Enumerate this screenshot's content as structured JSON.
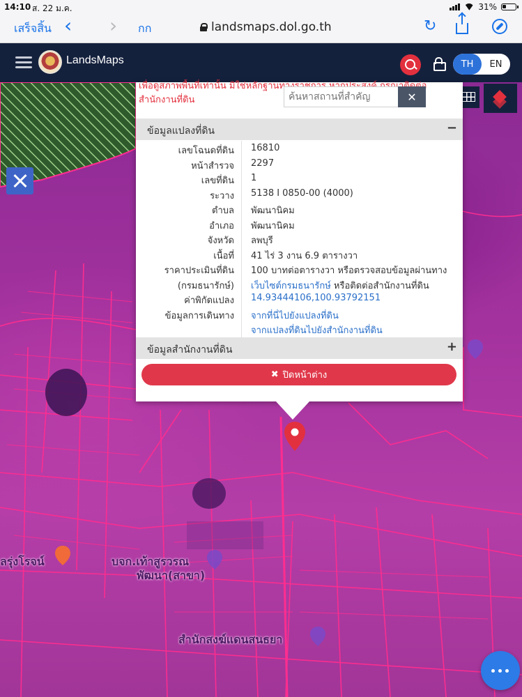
{
  "status_bar": {
    "time": "14:10",
    "date": "ส. 22 ม.ค.",
    "battery": "31%"
  },
  "browser": {
    "done_label": "เสร็จสิ้น",
    "back_glyph": "‹",
    "forward_glyph": "›",
    "text_size_label": "กก",
    "url": "landsmaps.dol.go.th",
    "reload_glyph": "↻"
  },
  "app": {
    "brand": "LandsMaps",
    "lang_th": "TH",
    "lang_en": "EN"
  },
  "popup": {
    "warning": "เพื่อดูสภาพพื้นที่เท่านั้น มิใช่หลักฐานทางราชการ หากประสงค์ กรุณาติดต่อ สำนักงานที่ดิน",
    "search_placeholder": "ค้นหาสถานที่สำคัญ",
    "search_close": "✕",
    "section_parcel": "ข้อมูลแปลงที่ดิน",
    "section_parcel_toggle": "−",
    "section_office": "ข้อมูลสำนักงานที่ดิน",
    "section_office_toggle": "+",
    "rows": [
      {
        "label": "เลขโฉนดที่ดิน",
        "value": "16810"
      },
      {
        "label": "หน้าสำรวจ",
        "value": "2297"
      },
      {
        "label": "เลขที่ดิน",
        "value": "1"
      },
      {
        "label": "ระวาง",
        "value": "5138 I 0850-00 (4000)"
      },
      {
        "label": "ตำบล",
        "value": "พัฒนานิคม"
      },
      {
        "label": "อำเภอ",
        "value": "พัฒนานิคม"
      },
      {
        "label": "จังหวัด",
        "value": "ลพบุรี"
      },
      {
        "label": "เนื้อที่",
        "value": "41 ไร่ 3 งาน 6.9 ตารางวา"
      },
      {
        "label": "ราคาประเมินที่ดิน",
        "value": "100 บาทต่อตารางวา หรือตรวจสอบข้อมูลผ่านทาง"
      },
      {
        "label": "(กรมธนารักษ์)",
        "link": "เว็บไซต์กรมธนารักษ์",
        "value": " หรือติดต่อสำนักงานที่ดิน"
      },
      {
        "label": "ค่าพิกัดแปลง",
        "link": "14.93444106,100.93792151"
      },
      {
        "label": "ข้อมูลการเดินทาง",
        "link": "จากที่นี่ไปยังแปลงที่ดิน"
      },
      {
        "label": "",
        "link": "จากแปลงที่ดินไปยังสำนักงานที่ดิน"
      }
    ],
    "close_label": "ปิดหน้าต่าง",
    "close_icon": "✖"
  },
  "map": {
    "labels": {
      "district_left": "ลรุ่งโรจน์",
      "school_line1": "บจก.เท้าสูรวรณ",
      "school_line2": "พัฒนา(สาขา)",
      "office": "สำนักสงฆ์แดนสนธยา"
    },
    "colors": {
      "parcel_line": "#ff2d8f",
      "pin": "#e3303e",
      "accent": "#2d72d9"
    }
  }
}
